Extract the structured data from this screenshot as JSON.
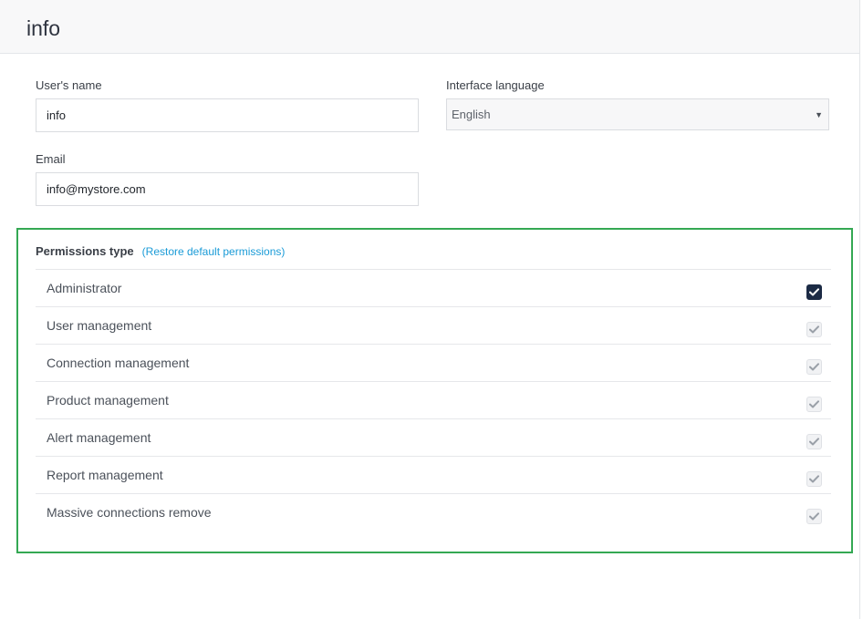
{
  "header": {
    "title": "info"
  },
  "form": {
    "username": {
      "label": "User's name",
      "value": "info"
    },
    "language": {
      "label": "Interface language",
      "value": "English"
    },
    "email": {
      "label": "Email",
      "value": "info@mystore.com"
    }
  },
  "permissions": {
    "title": "Permissions type",
    "restore_label": "(Restore default permissions)",
    "items": [
      {
        "label": "Administrator",
        "checked": true,
        "enabled": true
      },
      {
        "label": "User management",
        "checked": true,
        "enabled": false
      },
      {
        "label": "Connection management",
        "checked": true,
        "enabled": false
      },
      {
        "label": "Product management",
        "checked": true,
        "enabled": false
      },
      {
        "label": "Alert management",
        "checked": true,
        "enabled": false
      },
      {
        "label": "Report management",
        "checked": true,
        "enabled": false
      },
      {
        "label": "Massive connections remove",
        "checked": true,
        "enabled": false
      }
    ]
  },
  "colors": {
    "highlight_border": "#34a853",
    "link": "#1a9bd7",
    "checkbox_active": "#1c2b45"
  },
  "icons": {
    "checkbox": "checkmark-icon",
    "select": "caret-down-icon"
  }
}
